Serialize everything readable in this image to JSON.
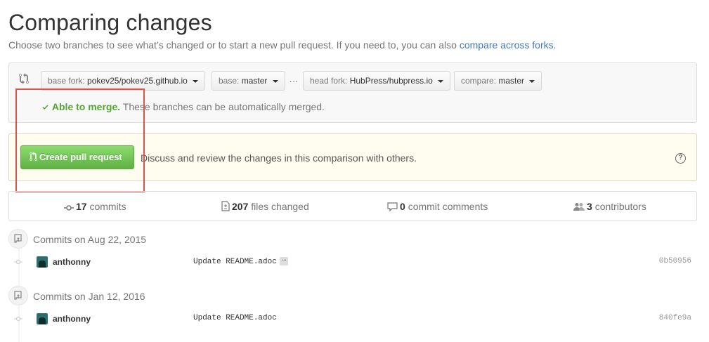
{
  "header": {
    "title": "Comparing changes",
    "subtitle_text": "Choose two branches to see what’s changed or to start a new pull request. If you need to, you can also",
    "subtitle_link": "compare across forks",
    "subtitle_end": "."
  },
  "range": {
    "base_fork_prefix": "base fork:",
    "base_fork_value": "pokev25/pokev25.github.io",
    "base_prefix": "base:",
    "base_value": "master",
    "dots": "...",
    "head_fork_prefix": "head fork:",
    "head_fork_value": "HubPress/hubpress.io",
    "compare_prefix": "compare:",
    "compare_value": "master",
    "merge_ok": "Able to merge.",
    "merge_text": "These branches can be automatically merged."
  },
  "pr": {
    "button_label": "Create pull request",
    "description": "Discuss and review the changes in this comparison with others.",
    "help_glyph": "?"
  },
  "summary": {
    "commits_count": "17",
    "commits_label": "commits",
    "files_count": "207",
    "files_label": "files changed",
    "comments_count": "0",
    "comments_label": "commit comments",
    "contributors_count": "3",
    "contributors_label": "contributors"
  },
  "commit_groups": [
    {
      "label": "Commits on Aug 22, 2015",
      "commits": [
        {
          "author": "anthonny",
          "message": "Update README.adoc",
          "ellipsis": "…",
          "sha": "0b50956"
        }
      ]
    },
    {
      "label": "Commits on Jan 12, 2016",
      "commits": [
        {
          "author": "anthonny",
          "message": "Update README.adoc",
          "sha": "840fe9a"
        }
      ]
    }
  ],
  "colors": {
    "link": "#4078c0",
    "success": "#55a532",
    "primary_button": "#60b044",
    "annotation": "#d9534f"
  },
  "icons": [
    "compare-icon",
    "check-icon",
    "git-pull-request-icon",
    "question-icon",
    "commit-icon",
    "file-diff-icon",
    "comment-icon",
    "people-icon",
    "repo-push-icon"
  ]
}
